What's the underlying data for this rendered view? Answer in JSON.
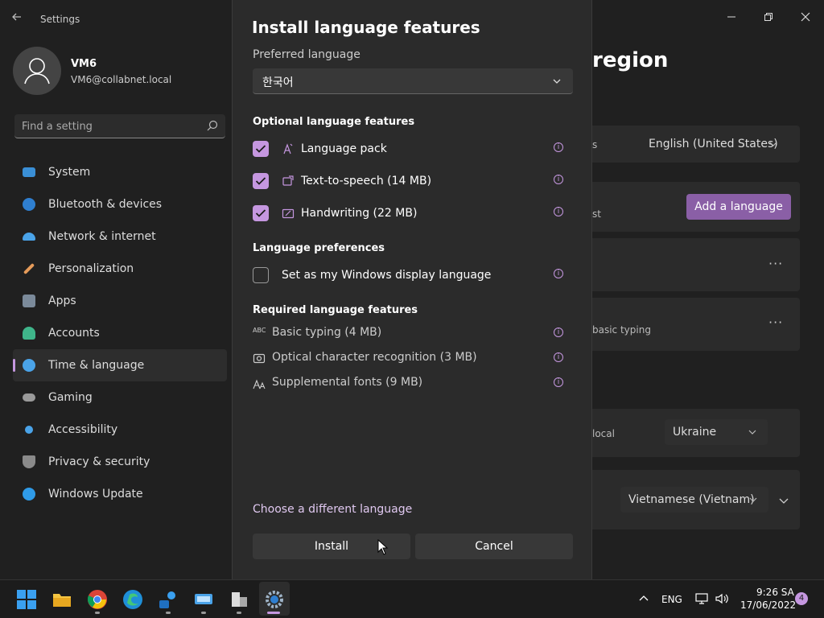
{
  "window": {
    "app_title": "Settings"
  },
  "user": {
    "name": "VM6",
    "email": "VM6@collabnet.local"
  },
  "search": {
    "placeholder": "Find a setting"
  },
  "sidebar": {
    "items": [
      {
        "label": "System",
        "icon": "system-icon",
        "color": "#3a8fd6"
      },
      {
        "label": "Bluetooth & devices",
        "icon": "bluetooth-icon",
        "color": "#2f7fd0"
      },
      {
        "label": "Network & internet",
        "icon": "wifi-icon",
        "color": "#4aa3e8"
      },
      {
        "label": "Personalization",
        "icon": "brush-icon",
        "color": "#e59b5a"
      },
      {
        "label": "Apps",
        "icon": "apps-icon",
        "color": "#7b8a9a"
      },
      {
        "label": "Accounts",
        "icon": "person-icon",
        "color": "#3fb58a"
      },
      {
        "label": "Time & language",
        "icon": "clock-globe-icon",
        "color": "#4aa3e8"
      },
      {
        "label": "Gaming",
        "icon": "gamepad-icon",
        "color": "#9a9a9a"
      },
      {
        "label": "Accessibility",
        "icon": "accessibility-icon",
        "color": "#4aa3e8"
      },
      {
        "label": "Privacy & security",
        "icon": "shield-icon",
        "color": "#8a8a8a"
      },
      {
        "label": "Windows Update",
        "icon": "update-icon",
        "color": "#2f9be8"
      }
    ],
    "active_index": 6
  },
  "background": {
    "page_title": "region",
    "display_language": "English (United States)",
    "add_language_label": "Add a language",
    "basic_typing": "basic typing",
    "country_suffix": "local",
    "country": "Ukraine",
    "regional_format": "Vietnamese (Vietnam)",
    "dot_menu": "···",
    "fragment_s": "s",
    "fragment_st": "st"
  },
  "dialog": {
    "title": "Install language features",
    "preferred_label": "Preferred language",
    "preferred_value": "한국어",
    "optional_header": "Optional language features",
    "optional": [
      {
        "label": "Language pack",
        "checked": true,
        "icon": "language-pack-icon"
      },
      {
        "label": "Text-to-speech (14 MB)",
        "checked": true,
        "icon": "speech-icon"
      },
      {
        "label": "Handwriting (22 MB)",
        "checked": true,
        "icon": "pen-icon"
      }
    ],
    "prefs_header": "Language preferences",
    "prefs_item": "Set as my Windows display language",
    "required_header": "Required language features",
    "required": [
      {
        "label": "Basic typing (4 MB)",
        "icon": "abc-icon"
      },
      {
        "label": "Optical character recognition (3 MB)",
        "icon": "ocr-icon"
      },
      {
        "label": "Supplemental fonts (9 MB)",
        "icon": "font-icon"
      }
    ],
    "choose_link": "Choose a different language",
    "install_label": "Install",
    "cancel_label": "Cancel",
    "info_glyph": "i",
    "abc_glyph": "ABC"
  },
  "taskbar": {
    "language": "ENG",
    "time": "9:26 SA",
    "date": "17/06/2022",
    "notifications": "4"
  }
}
